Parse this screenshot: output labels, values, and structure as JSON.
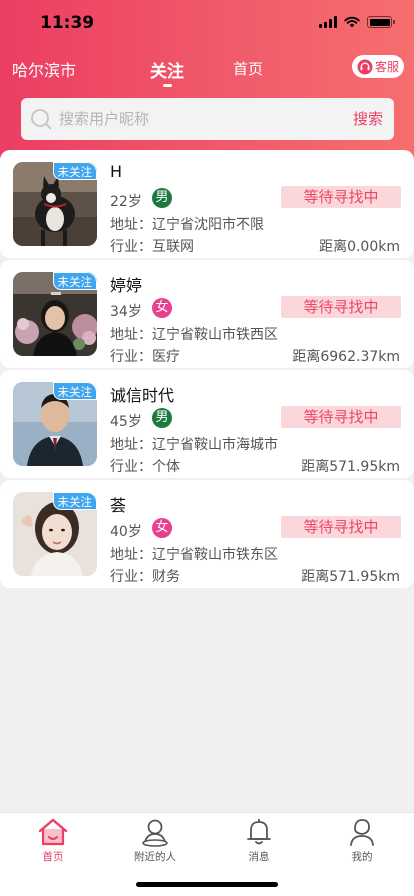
{
  "status_bar": {
    "time": "11:39"
  },
  "header": {
    "city": "哈尔滨市",
    "tab_follow": "关注",
    "tab_home": "首页",
    "service": "客服"
  },
  "search": {
    "placeholder": "搜索用户昵称",
    "button": "搜索"
  },
  "users": [
    {
      "follow": "未关注",
      "name": "H",
      "age": "22岁",
      "gender": "男",
      "gender_type": "male",
      "status": "等待寻找中",
      "address": "地址：辽宁省沈阳市不限",
      "industry": "行业：互联网",
      "distance": "距离0.00km",
      "avatar_icon": "dog-photo"
    },
    {
      "follow": "未关注",
      "name": "婷婷",
      "age": "34岁",
      "gender": "女",
      "gender_type": "female",
      "status": "等待寻找中",
      "address": "地址：辽宁省鞍山市铁西区",
      "industry": "行业：医疗",
      "distance": "距离6962.37km",
      "avatar_icon": "woman-with-flowers-photo"
    },
    {
      "follow": "未关注",
      "name": "诚信时代",
      "age": "45岁",
      "gender": "男",
      "gender_type": "male",
      "status": "等待寻找中",
      "address": "地址：辽宁省鞍山市海城市",
      "industry": "行业：个体",
      "distance": "距离571.95km",
      "avatar_icon": "man-portrait-photo"
    },
    {
      "follow": "未关注",
      "name": "荟",
      "age": "40岁",
      "gender": "女",
      "gender_type": "female",
      "status": "等待寻找中",
      "address": "地址：辽宁省鞍山市铁东区",
      "industry": "行业：财务",
      "distance": "距离571.95km",
      "avatar_icon": "woman-selfie-photo"
    }
  ],
  "tabbar": {
    "items": [
      {
        "label": "首页",
        "icon": "home-icon",
        "active": true
      },
      {
        "label": "附近的人",
        "icon": "nearby-person-icon",
        "active": false
      },
      {
        "label": "消息",
        "icon": "bell-icon",
        "active": false
      },
      {
        "label": "我的",
        "icon": "profile-icon",
        "active": false
      }
    ]
  },
  "colors": {
    "brand": "#ea3e63",
    "follow_badge": "#3fa5ee",
    "status_tag_bg": "#fbd7dc",
    "male": "#1d7a3e",
    "female": "#e83f8e"
  }
}
